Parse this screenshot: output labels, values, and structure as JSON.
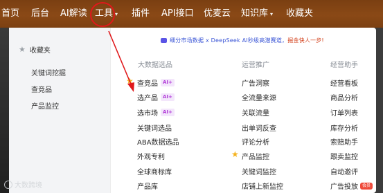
{
  "nav": {
    "items": [
      {
        "label": "首页"
      },
      {
        "label": "后台"
      },
      {
        "label": "AI解读"
      },
      {
        "label": "工具",
        "dropdown": true
      },
      {
        "label": "插件"
      },
      {
        "label": "API接口"
      },
      {
        "label": "优麦云"
      },
      {
        "label": "知识库",
        "dropdown": true
      },
      {
        "label": "收藏夹"
      }
    ]
  },
  "sidebar": {
    "title": "收藏夹",
    "links": [
      "关键词挖掘",
      "查竞品",
      "产品监控"
    ]
  },
  "banner": {
    "text": "细分市场数据 x DeepSeek AI秒级高潜赛道，",
    "tail": "掘金快人一步!"
  },
  "columns": [
    {
      "heading": "大数据选品",
      "items": [
        {
          "label": "查竞品",
          "badge": "AI+",
          "starred": true
        },
        {
          "label": "选产品",
          "badge": "AI+"
        },
        {
          "label": "选市场",
          "badge": "AI+"
        },
        {
          "label": "关键词选品"
        },
        {
          "label": "ABA数据选品"
        },
        {
          "label": "外观专利"
        },
        {
          "label": "全球商标库"
        },
        {
          "label": "产品库"
        }
      ]
    },
    {
      "heading": "运营推广",
      "items": [
        {
          "label": "广告洞察"
        },
        {
          "label": "全流量来源"
        },
        {
          "label": "关联流量"
        },
        {
          "label": "出单词反查"
        },
        {
          "label": "评论分析"
        },
        {
          "label": "产品监控",
          "starred": true
        },
        {
          "label": "关键词监控"
        },
        {
          "label": "店铺上新监控"
        }
      ]
    },
    {
      "heading": "经营助手",
      "items": [
        {
          "label": "经营看板"
        },
        {
          "label": "商品分析"
        },
        {
          "label": "订单列表"
        },
        {
          "label": "库存分析"
        },
        {
          "label": "索赔助手"
        },
        {
          "label": "跟卖监控"
        },
        {
          "label": "自动邀评"
        },
        {
          "label": "广告投放",
          "badge_new": "会员"
        }
      ]
    }
  ],
  "watermark": "大数跨境",
  "colors": {
    "topbar": "#8a4916",
    "highlight_circle": "#e0181b",
    "annotation_arrow": "#e0181b",
    "ai_badge": "#b23bd8",
    "star": "#f5b21d"
  }
}
